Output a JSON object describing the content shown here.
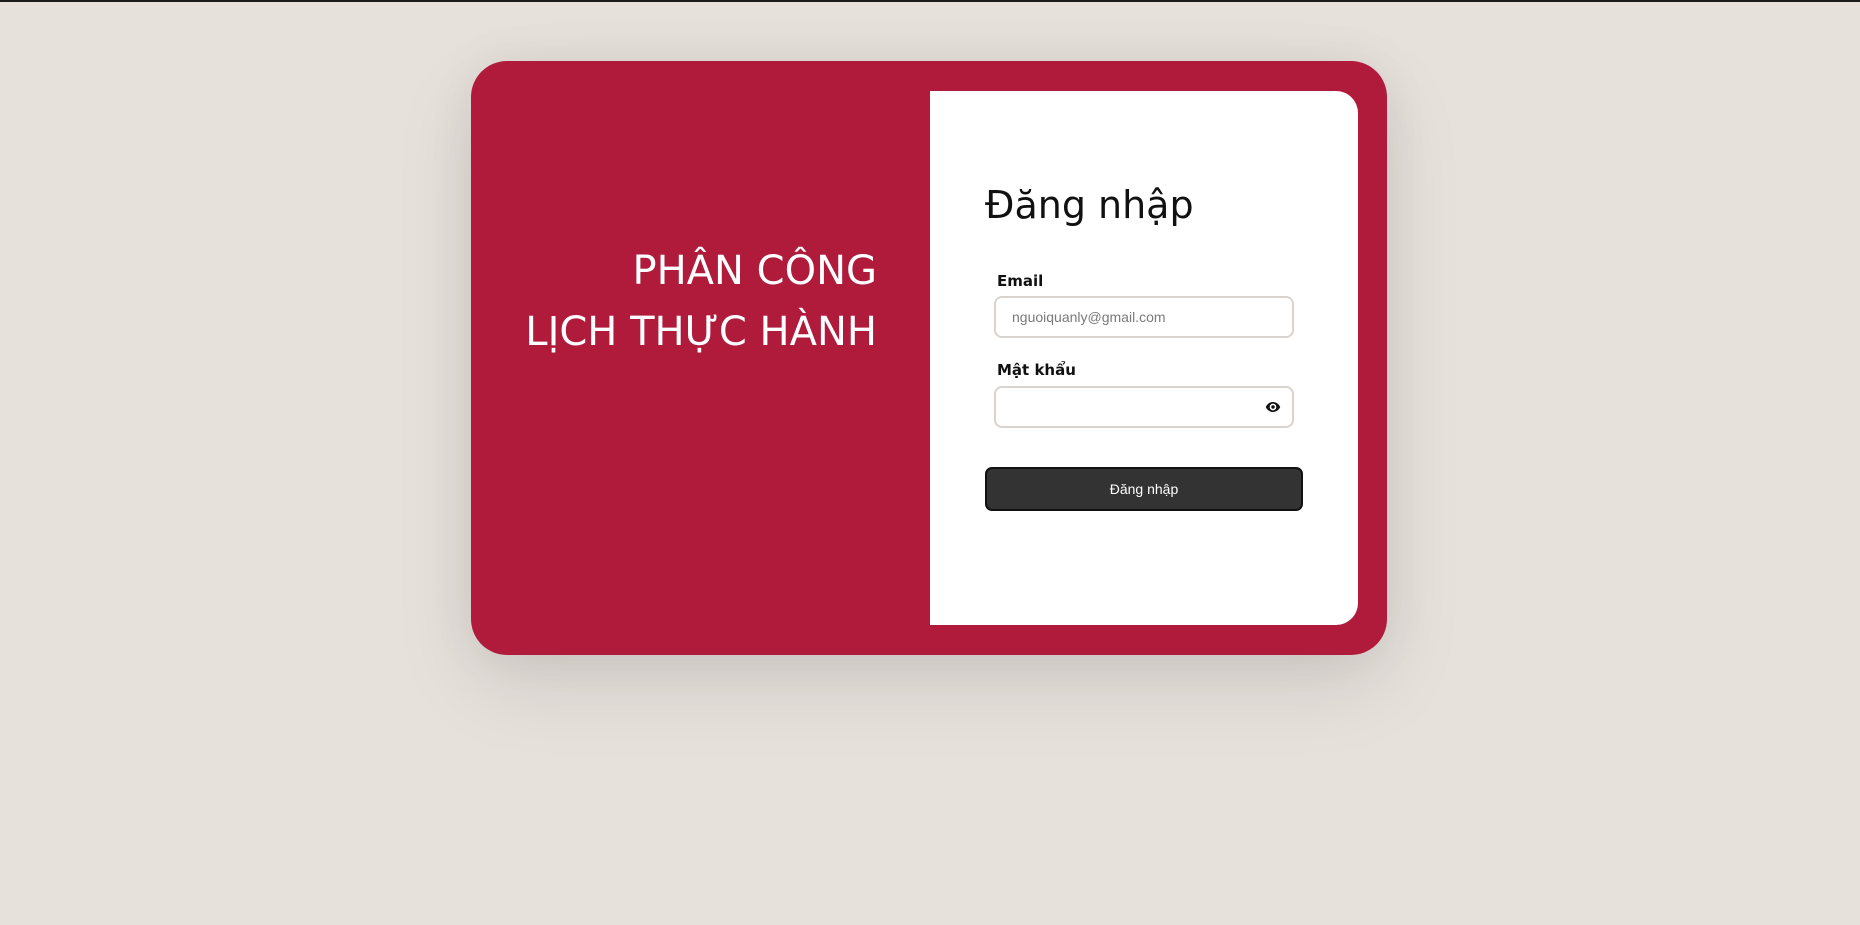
{
  "brand": {
    "line1": "PHÂN CÔNG",
    "line2": "LỊCH THỰC HÀNH"
  },
  "login": {
    "title": "Đăng nhập",
    "email_label": "Email",
    "email_placeholder": "nguoiquanly@gmail.com",
    "email_value": "",
    "password_label": "Mật khẩu",
    "password_value": "",
    "toggle_icon": "eye-icon",
    "submit_label": "Đăng nhập"
  },
  "colors": {
    "background": "#e7e1dc",
    "card": "#b01b3b",
    "panel": "#ffffff",
    "button": "#333333"
  }
}
